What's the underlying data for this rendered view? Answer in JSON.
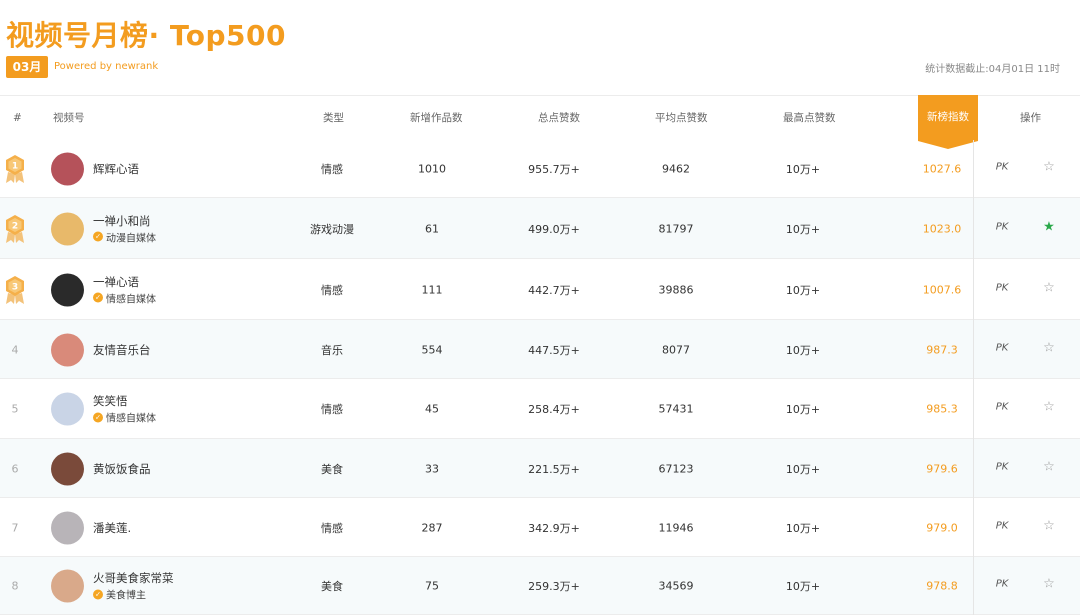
{
  "page": {
    "title": "视频号月榜· Top500",
    "month": "03月",
    "powered_by": "Powered by newrank",
    "stat_date": "统计数据截止:04月01日 11时"
  },
  "headers": {
    "rank": "#",
    "account": "视频号",
    "type": "类型",
    "new_works": "新增作品数",
    "total_likes": "总点赞数",
    "avg_likes": "平均点赞数",
    "max_likes": "最高点赞数",
    "index": "新榜指数",
    "actions": "操作"
  },
  "actions": {
    "pk_label": "PK"
  },
  "colors": {
    "accent": "#f39c1f",
    "fav_on": "#2aa84a",
    "medal": "#f5b04a"
  },
  "rows": [
    {
      "rank": "1",
      "name": "辉辉心语",
      "verify": "",
      "type": "情感",
      "new_works": "1010",
      "total_likes": "955.7万+",
      "avg_likes": "9462",
      "max_likes": "10万+",
      "index": "1027.6",
      "favorited": false,
      "avatar_color": "#b5525a"
    },
    {
      "rank": "2",
      "name": "一禅小和尚",
      "verify": "动漫自媒体",
      "type": "游戏动漫",
      "new_works": "61",
      "total_likes": "499.0万+",
      "avg_likes": "81797",
      "max_likes": "10万+",
      "index": "1023.0",
      "favorited": true,
      "avatar_color": "#e8b96a"
    },
    {
      "rank": "3",
      "name": "一禅心语",
      "verify": "情感自媒体",
      "type": "情感",
      "new_works": "111",
      "total_likes": "442.7万+",
      "avg_likes": "39886",
      "max_likes": "10万+",
      "index": "1007.6",
      "favorited": false,
      "avatar_color": "#2a2a2a"
    },
    {
      "rank": "4",
      "name": "友情音乐台",
      "verify": "",
      "type": "音乐",
      "new_works": "554",
      "total_likes": "447.5万+",
      "avg_likes": "8077",
      "max_likes": "10万+",
      "index": "987.3",
      "favorited": false,
      "avatar_color": "#d98a7a"
    },
    {
      "rank": "5",
      "name": "笑笑悟",
      "verify": "情感自媒体",
      "type": "情感",
      "new_works": "45",
      "total_likes": "258.4万+",
      "avg_likes": "57431",
      "max_likes": "10万+",
      "index": "985.3",
      "favorited": false,
      "avatar_color": "#c9d4e6"
    },
    {
      "rank": "6",
      "name": "黄饭饭食品",
      "verify": "",
      "type": "美食",
      "new_works": "33",
      "total_likes": "221.5万+",
      "avg_likes": "67123",
      "max_likes": "10万+",
      "index": "979.6",
      "favorited": false,
      "avatar_color": "#7a4a3a"
    },
    {
      "rank": "7",
      "name": "潘美莲.",
      "verify": "",
      "type": "情感",
      "new_works": "287",
      "total_likes": "342.9万+",
      "avg_likes": "11946",
      "max_likes": "10万+",
      "index": "979.0",
      "favorited": false,
      "avatar_color": "#b8b4b8"
    },
    {
      "rank": "8",
      "name": "火哥美食家常菜",
      "verify": "美食博主",
      "type": "美食",
      "new_works": "75",
      "total_likes": "259.3万+",
      "avg_likes": "34569",
      "max_likes": "10万+",
      "index": "978.8",
      "favorited": false,
      "avatar_color": "#d9a98a"
    }
  ]
}
